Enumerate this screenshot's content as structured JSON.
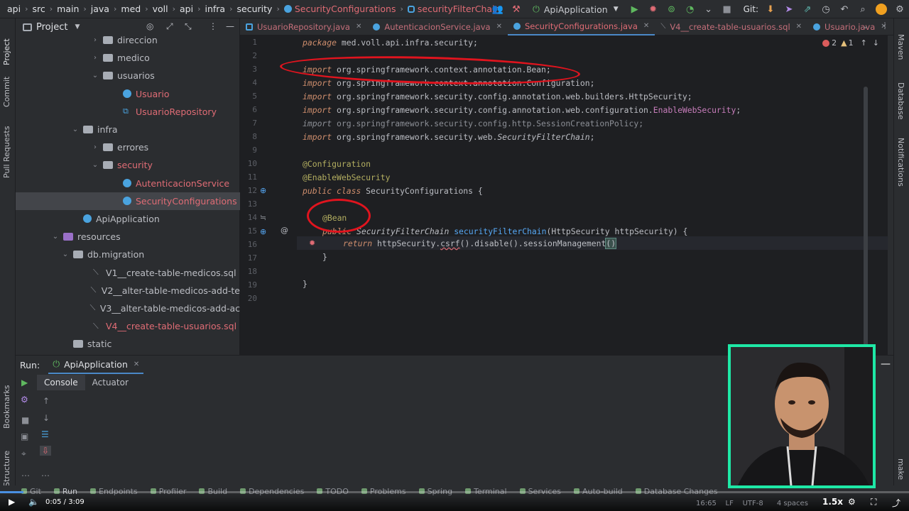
{
  "breadcrumb": {
    "items": [
      "api",
      "src",
      "main",
      "java",
      "med",
      "voll",
      "api",
      "infra",
      "security"
    ],
    "file": "SecurityConfigurations",
    "method": "securityFilterChain"
  },
  "toolbar": {
    "run_config": "ApiApplication",
    "git_label": "Git:"
  },
  "left_strip": {
    "project": "Project",
    "commit": "Commit",
    "pull_requests": "Pull Requests",
    "bookmarks": "Bookmarks",
    "structure": "Structure"
  },
  "project_panel": {
    "title": "Project",
    "tree": [
      {
        "label": "direccion",
        "kind": "package",
        "indent": 1,
        "chevron": "›",
        "color": "def"
      },
      {
        "label": "medico",
        "kind": "package",
        "indent": 1,
        "chevron": "›",
        "color": "def"
      },
      {
        "label": "usuarios",
        "kind": "package",
        "indent": 1,
        "chevron": "⌄",
        "color": "def"
      },
      {
        "label": "Usuario",
        "kind": "class",
        "indent": 2,
        "chevron": "",
        "color": "red"
      },
      {
        "label": "UsuarioRepository",
        "kind": "iface",
        "indent": 2,
        "chevron": "",
        "color": "red"
      },
      {
        "label": "infra",
        "kind": "package",
        "indent": 0,
        "chevron": "⌄",
        "color": "def"
      },
      {
        "label": "errores",
        "kind": "package",
        "indent": 1,
        "chevron": "›",
        "color": "def"
      },
      {
        "label": "security",
        "kind": "package",
        "indent": 1,
        "chevron": "⌄",
        "color": "red"
      },
      {
        "label": "AutenticacionService",
        "kind": "class",
        "indent": 2,
        "chevron": "",
        "color": "red"
      },
      {
        "label": "SecurityConfigurations",
        "kind": "class",
        "indent": 2,
        "chevron": "",
        "color": "red",
        "selected": true
      },
      {
        "label": "ApiApplication",
        "kind": "class",
        "indent": 0,
        "chevron": "",
        "color": "def"
      },
      {
        "label": "resources",
        "kind": "res",
        "indent": -1,
        "chevron": "⌄",
        "color": "def"
      },
      {
        "label": "db.migration",
        "kind": "package",
        "indent": -0.5,
        "chevron": "⌄",
        "color": "def"
      },
      {
        "label": "V1__create-table-medicos.sql",
        "kind": "sql",
        "indent": 0.5,
        "chevron": "",
        "color": "def"
      },
      {
        "label": "V2__alter-table-medicos-add-te",
        "kind": "sql",
        "indent": 0.5,
        "chevron": "",
        "color": "def"
      },
      {
        "label": "V3__alter-table-medicos-add-ac",
        "kind": "sql",
        "indent": 0.5,
        "chevron": "",
        "color": "def"
      },
      {
        "label": "V4__create-table-usuarios.sql",
        "kind": "sql",
        "indent": 0.5,
        "chevron": "",
        "color": "red"
      },
      {
        "label": "static",
        "kind": "package",
        "indent": -0.5,
        "chevron": "",
        "color": "def"
      }
    ]
  },
  "editor_tabs": [
    {
      "label": "UsuarioRepository.java",
      "icon": "m",
      "active": false
    },
    {
      "label": "AutenticacionService.java",
      "icon": "c",
      "active": false
    },
    {
      "label": "SecurityConfigurations.java",
      "icon": "c",
      "active": true
    },
    {
      "label": "V4__create-table-usuarios.sql",
      "icon": "sql",
      "active": false
    },
    {
      "label": "Usuario.java",
      "icon": "c",
      "active": false
    }
  ],
  "editor": {
    "error_count": "2",
    "warning_count": "1",
    "line_numbers": [
      "1",
      "2",
      "3",
      "4",
      "5",
      "6",
      "7",
      "8",
      "9",
      "10",
      "11",
      "12",
      "13",
      "14",
      "15",
      "16",
      "17",
      "18",
      "19",
      "20"
    ],
    "code": {
      "l1_kw": "package",
      "l1_rest": " med.voll.api.infra.security;",
      "l3_kw": "import",
      "l3_rest": " org.springframework.context.annotation.Bean;",
      "l4_kw": "import",
      "l4_rest": " org.springframework.context.annotation.Configuration;",
      "l5_kw": "import",
      "l5_rest": " org.springframework.security.config.annotation.web.builders.HttpSecurity;",
      "l6_kw": "import",
      "l6_rest1": " org.springframework.security.config.annotation.web.configuration.",
      "l6_cls": "EnableWebSecurity",
      "l6_semi": ";",
      "l7_kw": "import",
      "l7_rest": " org.springframework.security.config.http.SessionCreationPolicy;",
      "l8_kw": "import",
      "l8_rest1": " org.springframework.security.web.",
      "l8_cls": "SecurityFilterChain",
      "l8_semi": ";",
      "l10": "@Configuration",
      "l11": "@EnableWebSecurity",
      "l12_kw": "public class",
      "l12_rest": " SecurityConfigurations {",
      "l14": "@Bean",
      "l15_kw": "public",
      "l15_type": "SecurityFilterChain",
      "l15_fn": "securityFilterChain",
      "l15_rest": "(HttpSecurity httpSecurity) {",
      "l16_kw": "return",
      "l16_a": " httpSecurity.",
      "l16_csrf": "csrf",
      "l16_b": "().disable().sessionManagement",
      "l16_c": "()",
      "l17": "}",
      "l19": "}"
    }
  },
  "right_strip": {
    "maven": "Maven",
    "database": "Database",
    "notifications": "Notifications",
    "make": "make"
  },
  "run_panel": {
    "run_label": "Run:",
    "tab": "ApiApplication",
    "subtabs": [
      "Console",
      "Actuator"
    ]
  },
  "tool_windows": [
    {
      "label": "Git",
      "active": false
    },
    {
      "label": "Run",
      "active": true
    },
    {
      "label": "Endpoints",
      "active": false
    },
    {
      "label": "Profiler",
      "active": false
    },
    {
      "label": "Build",
      "active": false
    },
    {
      "label": "Dependencies",
      "active": false
    },
    {
      "label": "TODO",
      "active": false
    },
    {
      "label": "Problems",
      "active": false
    },
    {
      "label": "Spring",
      "active": false
    },
    {
      "label": "Terminal",
      "active": false
    },
    {
      "label": "Services",
      "active": false
    },
    {
      "label": "Auto-build",
      "active": false
    },
    {
      "label": "Database Changes",
      "active": false
    }
  ],
  "status": {
    "position": "16:65",
    "line_sep": "LF",
    "encoding": "UTF-8",
    "indent": "4 spaces"
  },
  "video": {
    "current": "0:05",
    "duration": "3:09",
    "separator": "/",
    "speed": "1.5x",
    "progress": 0.026
  },
  "colors": {
    "accent": "#4a88c7",
    "annotation_red": "#e0141e",
    "webcam_border": "#1ee8a6",
    "progress": "#4a90e2"
  }
}
